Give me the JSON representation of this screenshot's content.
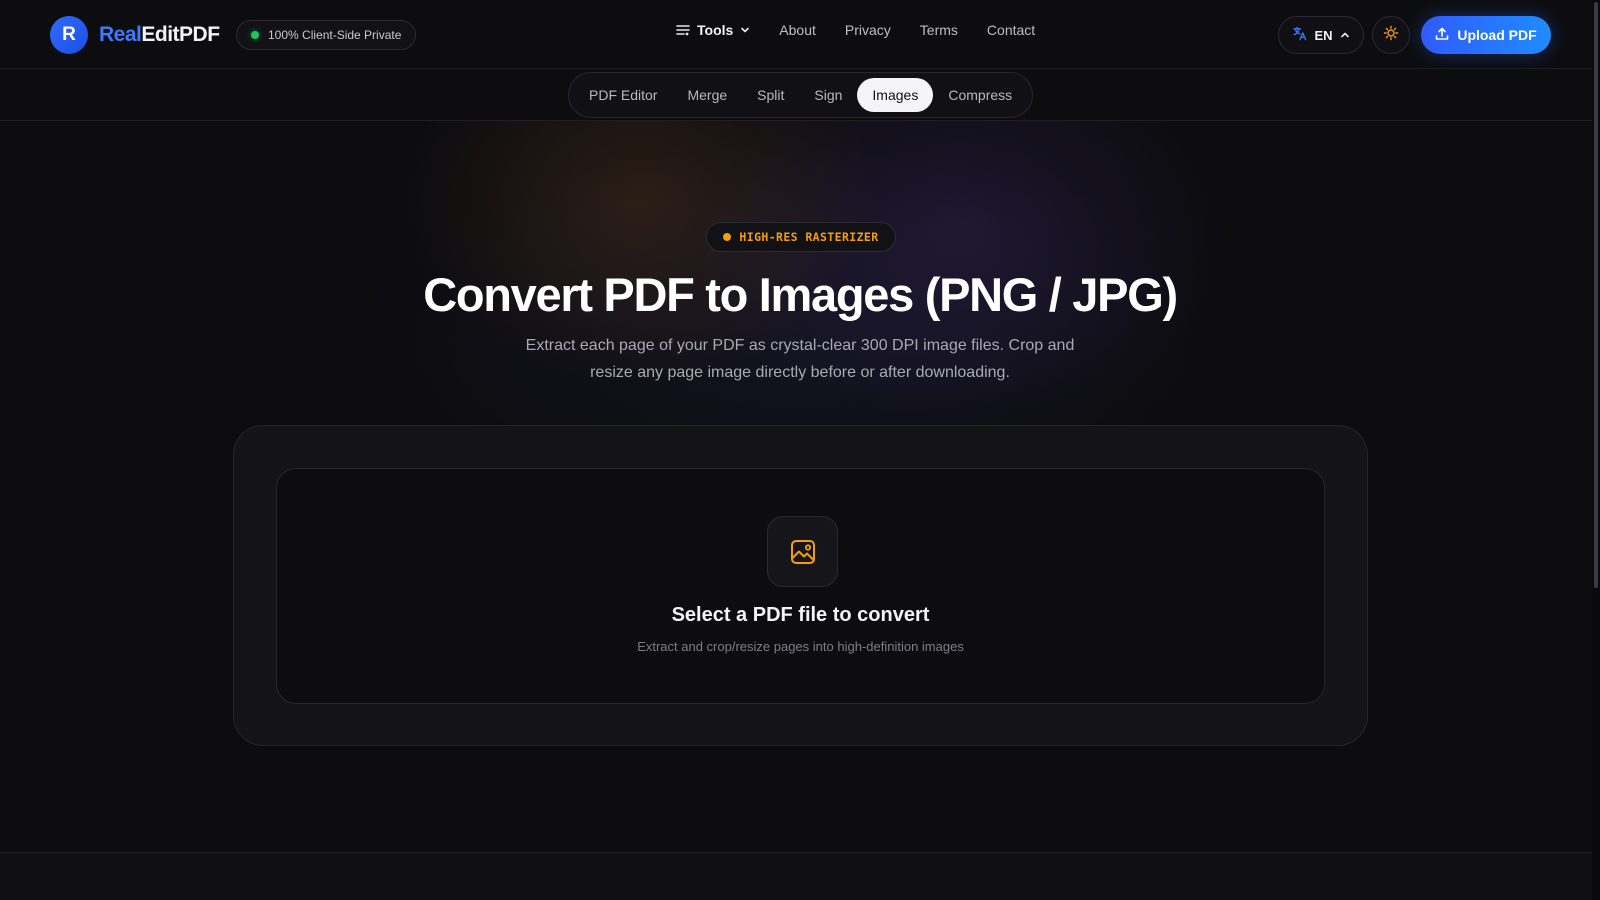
{
  "brand": {
    "badge": "R",
    "name_part1": "Real",
    "name_part2": "EditPDF"
  },
  "privacy_pill": {
    "label": "100% Client-Side Private"
  },
  "nav": {
    "tools_label": "Tools",
    "items": [
      "About",
      "Privacy",
      "Terms",
      "Contact"
    ]
  },
  "language": {
    "code": "EN"
  },
  "upload": {
    "label": "Upload PDF"
  },
  "subnav": {
    "tabs": [
      "PDF Editor",
      "Merge",
      "Split",
      "Sign",
      "Images",
      "Compress"
    ],
    "active": "Images"
  },
  "hero": {
    "badge": "HIGH-RES RASTERIZER",
    "title": "Convert PDF to Images (PNG / JPG)",
    "subtitle": "Extract each page of your PDF as crystal-clear 300 DPI image files. Crop and resize any page image directly before or after downloading."
  },
  "dropzone": {
    "title": "Select a PDF file to convert",
    "subtitle": "Extract and crop/resize pages into high-definition images"
  },
  "colors": {
    "brand_blue": "#3b7bff",
    "accent_amber": "#f59e0b",
    "status_green": "#22c55e",
    "background": "#0c0c0f"
  },
  "icons": {
    "brand": "logo-badge",
    "tools": "tools-menu-icon",
    "tools_chevron": "chevron-down-icon",
    "language": "translate-icon",
    "language_chevron": "chevron-up-icon",
    "theme": "sun-icon",
    "upload": "upload-icon",
    "dropzone": "image-icon"
  }
}
